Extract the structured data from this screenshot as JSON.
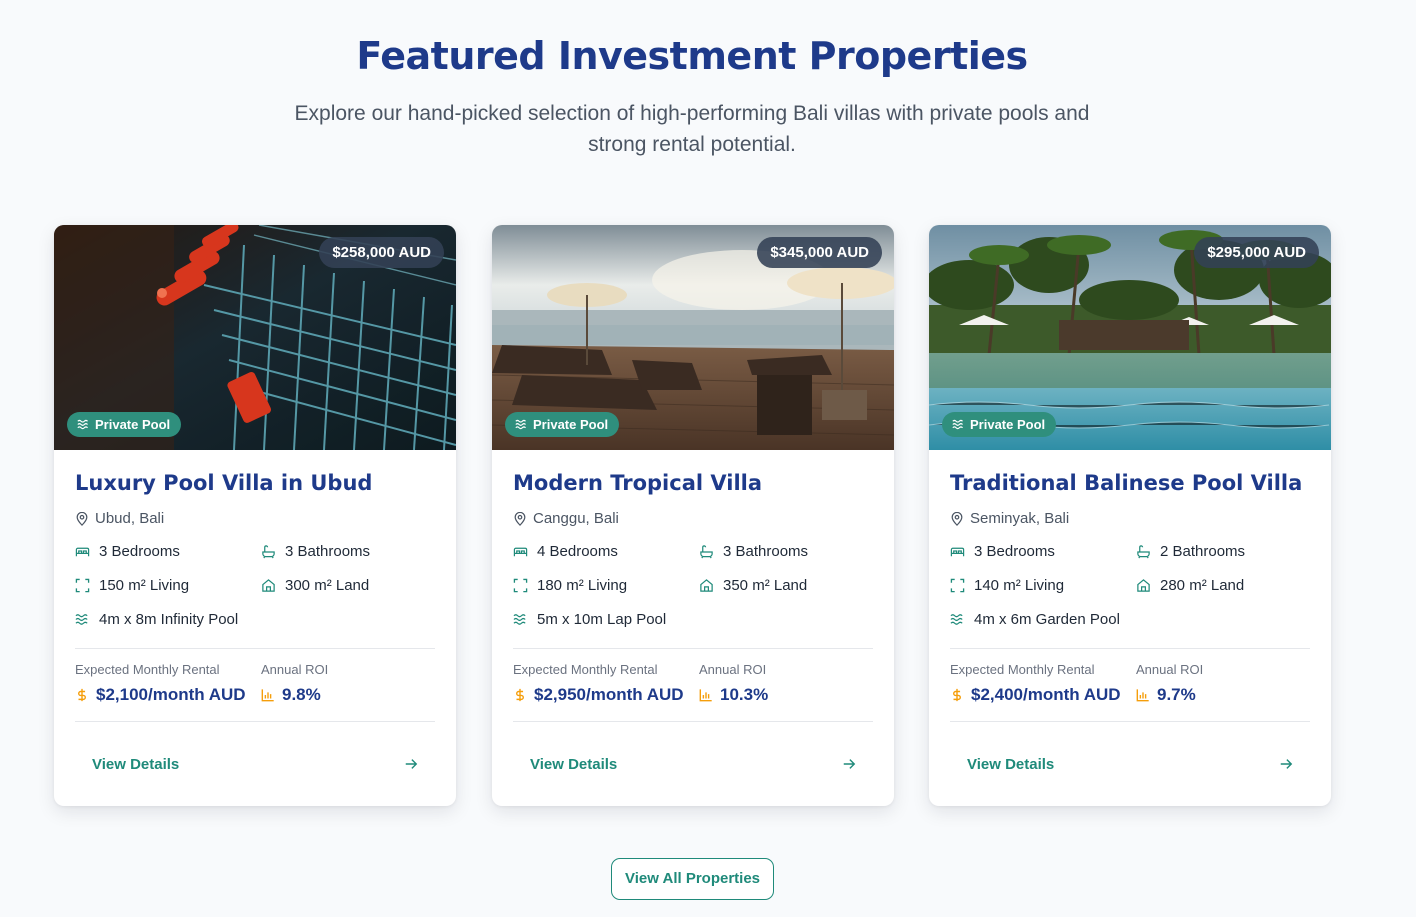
{
  "header": {
    "title": "Featured Investment Properties",
    "subtitle": "Explore our hand-picked selection of high-performing Bali villas with private pools and strong rental potential."
  },
  "colors": {
    "brand_navy": "#1e3a8a",
    "accent_teal": "#1f8a7a",
    "badge_teal": "#2f8f7d",
    "money_gold": "#f59e0b"
  },
  "labels": {
    "rental_label": "Expected Monthly Rental",
    "roi_label": "Annual ROI",
    "details_label": "View Details"
  },
  "icons": {
    "pool_badge": "waves-icon",
    "location": "map-pin-icon",
    "bedrooms": "bed-icon",
    "bathrooms": "bath-icon",
    "living": "expand-icon",
    "land": "home-icon",
    "pool": "waves-icon",
    "rental": "dollar-icon",
    "roi": "bar-chart-icon",
    "details": "arrow-right-icon"
  },
  "properties": [
    {
      "price": "$258,000 AUD",
      "badge": "Private Pool",
      "title": "Luxury Pool Villa in Ubud",
      "location": "Ubud, Bali",
      "bedrooms": "3 Bedrooms",
      "bathrooms": "3 Bathrooms",
      "living": "150 m² Living",
      "land": "300 m² Land",
      "pool": "4m x 8m Infinity Pool",
      "rental": "$2,100/month AUD",
      "roi": "9.8%"
    },
    {
      "price": "$345,000 AUD",
      "badge": "Private Pool",
      "title": "Modern Tropical Villa",
      "location": "Canggu, Bali",
      "bedrooms": "4 Bedrooms",
      "bathrooms": "3 Bathrooms",
      "living": "180 m² Living",
      "land": "350 m² Land",
      "pool": "5m x 10m Lap Pool",
      "rental": "$2,950/month AUD",
      "roi": "10.3%"
    },
    {
      "price": "$295,000 AUD",
      "badge": "Private Pool",
      "title": "Traditional Balinese Pool Villa",
      "location": "Seminyak, Bali",
      "bedrooms": "3 Bedrooms",
      "bathrooms": "2 Bathrooms",
      "living": "140 m² Living",
      "land": "280 m² Land",
      "pool": "4m x 6m Garden Pool",
      "rental": "$2,400/month AUD",
      "roi": "9.7%"
    }
  ],
  "footer": {
    "view_all_label": "View All Properties"
  }
}
